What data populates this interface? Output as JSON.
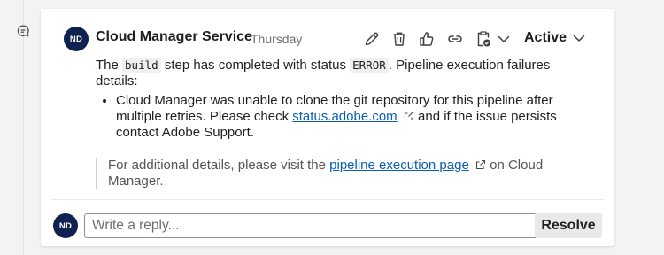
{
  "comment": {
    "avatar_initials": "ND",
    "author": "Cloud Manager Service",
    "date": "Thursday",
    "status": "Active",
    "body": {
      "intro_prefix": "The",
      "intro_code1": "build",
      "intro_middle": "step has completed with status",
      "intro_code2": "ERROR",
      "intro_suffix": ". Pipeline execution failures details:",
      "bullet_prefix": "Cloud Manager was unable to clone the git repository for this pipeline after multiple retries. Please check",
      "bullet_link": "status.adobe.com",
      "bullet_suffix": "and if the issue persists contact Adobe Support."
    },
    "quote": {
      "prefix": "For additional details, please visit the",
      "link": "pipeline execution page",
      "suffix": "on Cloud Manager."
    }
  },
  "reply": {
    "avatar_initials": "ND",
    "placeholder": "Write a reply...",
    "resolve_label": "Resolve"
  },
  "icons": {
    "gutter": "comment-icon",
    "toolbar": [
      "edit-icon",
      "delete-icon",
      "thumbs-up-icon",
      "link-icon",
      "clipboard-check-icon",
      "chevron-down-icon"
    ],
    "status": "chevron-down-icon",
    "external": "external-link-icon"
  },
  "colors": {
    "avatar": "#0e2151",
    "link": "#0b5cb5",
    "resolve_button": "#e9e9e9"
  }
}
